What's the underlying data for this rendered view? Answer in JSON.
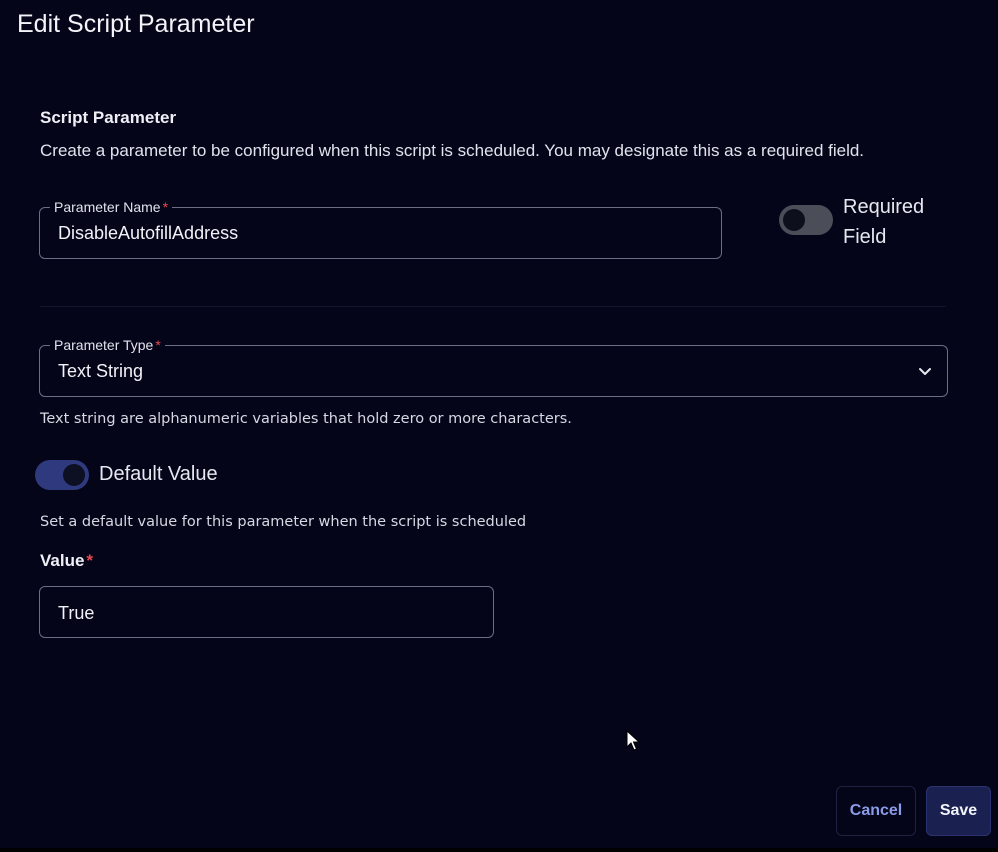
{
  "dialog": {
    "title": "Edit Script Parameter"
  },
  "section": {
    "title": "Script Parameter",
    "description": "Create a parameter to be configured when this script is scheduled. You may designate this as a required field."
  },
  "parameter_name": {
    "label": "Parameter Name",
    "required_marker": "*",
    "value": "DisableAutofillAddress"
  },
  "required_field": {
    "label": "Required Field",
    "enabled": false
  },
  "parameter_type": {
    "label": "Parameter Type",
    "required_marker": "*",
    "selected": "Text String",
    "helper": "Text string are alphanumeric variables that hold zero or more characters."
  },
  "default_value": {
    "label": "Default Value",
    "enabled": true,
    "helper": "Set a default value for this parameter when the script is scheduled"
  },
  "value": {
    "label": "Value",
    "required_marker": "*",
    "value": "True"
  },
  "buttons": {
    "cancel_label": "Cancel",
    "save_label": "Save"
  },
  "colors": {
    "background": "#05051a",
    "accent": "#2f3a7e",
    "required": "#e5484d",
    "cancel_text": "#8a9be8"
  }
}
